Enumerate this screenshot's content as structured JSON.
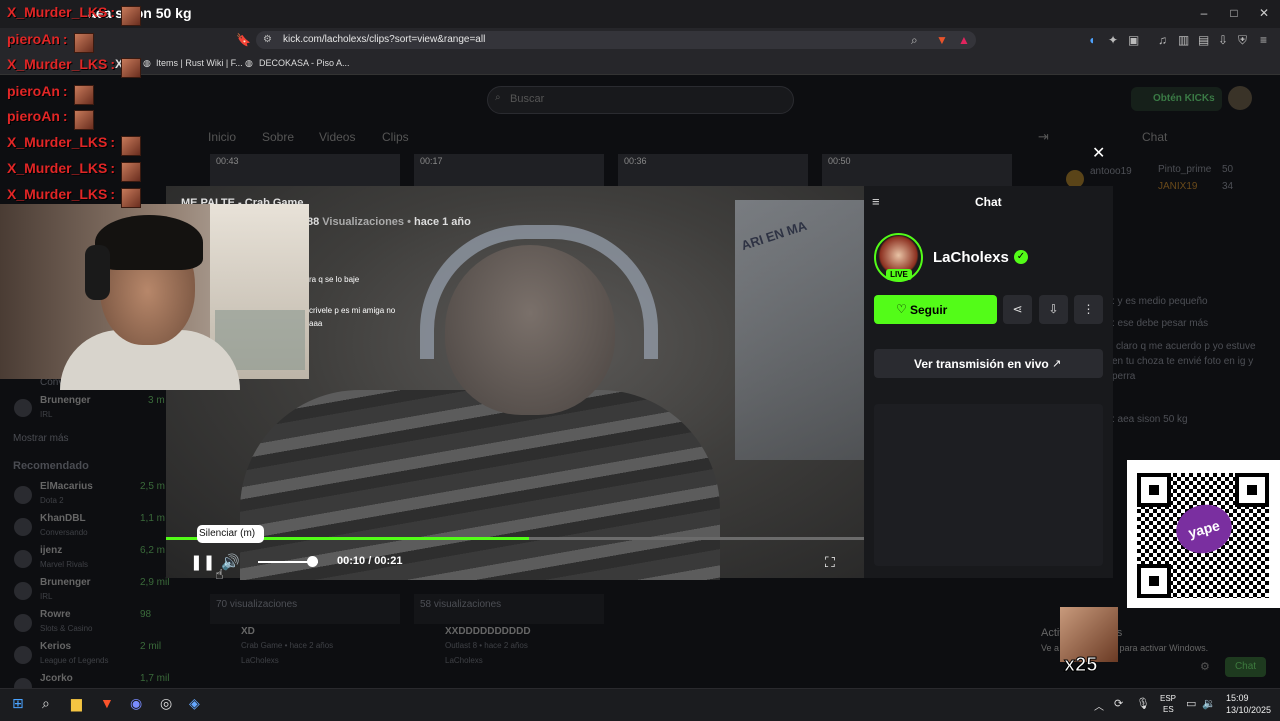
{
  "browser": {
    "tab_title": "aea sison 50 kg",
    "url": "kick.com/lacholexs/clips?sort=view&range=all",
    "bookmarks": [
      "XD",
      "Items | Rust Wiki | F...",
      "DECOKASA - Piso A..."
    ],
    "window_controls": [
      "–",
      "□",
      "✕"
    ]
  },
  "kick": {
    "search_placeholder": "Buscar",
    "kicks_button": "Obtén KICKs",
    "nav_tabs": [
      "Inicio",
      "Sobre",
      "Videos",
      "Clips"
    ],
    "chat_title": "Chat",
    "thumb_times": [
      "00:43",
      "00:17",
      "00:36",
      "00:50"
    ],
    "sidebar": {
      "following": [
        {
          "name": "Brunenger",
          "count": "3 m",
          "sub": "IRL"
        }
      ],
      "subtitle_conversando": "Conversando",
      "show_more": "Mostrar más",
      "recommended_title": "Recomendado",
      "recommended": [
        {
          "name": "ElMacarius",
          "count": "2,5 m",
          "sub": "Dota 2"
        },
        {
          "name": "KhanDBL",
          "count": "1,1 m",
          "sub": "Conversando"
        },
        {
          "name": "ijenz",
          "count": "6,2 m",
          "sub": "Marvel Rivals"
        },
        {
          "name": "Brunenger",
          "count": "2,9 mil",
          "sub": "IRL"
        },
        {
          "name": "Rowre",
          "count": "98",
          "sub": "Slots & Casino"
        },
        {
          "name": "Kerios",
          "count": "2 mil",
          "sub": "League of Legends"
        },
        {
          "name": "Jcorko",
          "count": "1,7 mil",
          "sub": ""
        }
      ]
    },
    "bg_chat": {
      "top_users": [
        "antooo19",
        "Pinto_prime",
        "JANIX19"
      ],
      "top_counts": [
        "50",
        "34"
      ],
      "lines": [
        ": y es medio pequeño",
        ": ese debe pesar más",
        "claro q me acuerdo p yo estuve",
        "en tu choza te envié foto en ig y",
        "perra",
        ": aea sison 50 kg"
      ]
    },
    "bottom_clips": [
      {
        "views": "70 visualizaciones",
        "title": "XD",
        "meta": "Crab Game • hace 2 años",
        "channel": "LaCholexs"
      },
      {
        "views": "58 visualizaciones",
        "title": "XXDDDDDDDDDD",
        "meta": "Outlast 8 • hace 2 años",
        "channel": "LaCholexs"
      }
    ],
    "chat_send": "Chat"
  },
  "stream_overlay_chat": [
    {
      "user": "X_Murder_LKS",
      "emote": true
    },
    {
      "user": "pieroAn",
      "emote": true
    },
    {
      "user": "X_Murder_LKS",
      "emote": true
    },
    {
      "user": "pieroAn",
      "emote": true
    },
    {
      "user": "pieroAn",
      "emote": true
    },
    {
      "user": "X_Murder_LKS",
      "emote": true
    },
    {
      "user": "X_Murder_LKS",
      "emote": true
    },
    {
      "user": "X_Murder_LKS",
      "emote": true
    }
  ],
  "modal": {
    "clip_title": "ME PALTE - Crab Game",
    "views_prefix": "88 ",
    "views_label": "Visualizaciones",
    "ago": "hace 1 año",
    "video_chat_lines": [
      "ra q se lo baje",
      "crivele p es mi amiga no",
      "aaa"
    ],
    "tooltip": "Silenciar (m)",
    "time": "00:10 / 00:21",
    "progress": 0.52,
    "volume": 0.9,
    "panel_title": "Chat",
    "channel_name": "LaCholexs",
    "live_badge": "LIVE",
    "follow_label": "Seguir",
    "live_button": "Ver transmisión en vivo",
    "wall_text": "ARI EN MA"
  },
  "overlay": {
    "qr_brand": "yape",
    "emote_count": "x25",
    "activate_title": "Activar Windows",
    "activate_sub": "Ve a Configuración para activar Windows."
  },
  "taskbar": {
    "lang1": "ESP",
    "lang2": "ES",
    "time": "15:09",
    "date": "13/10/2025"
  },
  "colors": {
    "kick_green": "#53fc18",
    "overlay_red": "#e12626",
    "qr_purple": "#7a2fa0"
  }
}
